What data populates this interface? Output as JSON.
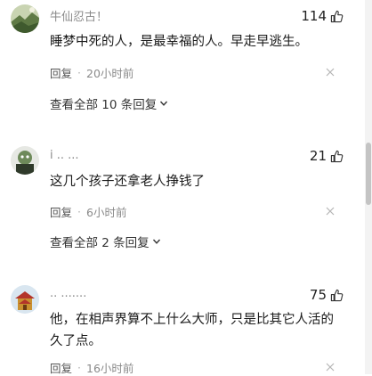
{
  "comments": [
    {
      "username": "牛仙忍古！",
      "likes": "114",
      "content": "睡梦中死的人，是最幸福的人。早走早逃生。",
      "reply_label": "回复",
      "time": "20小时前",
      "view_replies": "查看全部 10 条回复"
    },
    {
      "username": "i  ..  ...",
      "likes": "21",
      "content": "这几个孩子还拿老人挣钱了",
      "reply_label": "回复",
      "time": "6小时前",
      "view_replies": "查看全部 2 条回复"
    },
    {
      "username": "..  .......",
      "likes": "75",
      "content": "他，在相声界算不上什么大师，只是比其它人活的久了点。",
      "reply_label": "回复",
      "time": "16小时前"
    }
  ],
  "colors": {
    "text_primary": "#1a1a1a",
    "text_secondary": "#8a8a8a",
    "scroll_thumb": "#c4c4c4"
  },
  "icons": {
    "like": "thumb-up-icon",
    "dismiss": "close-icon",
    "expand": "chevron-down-icon"
  }
}
